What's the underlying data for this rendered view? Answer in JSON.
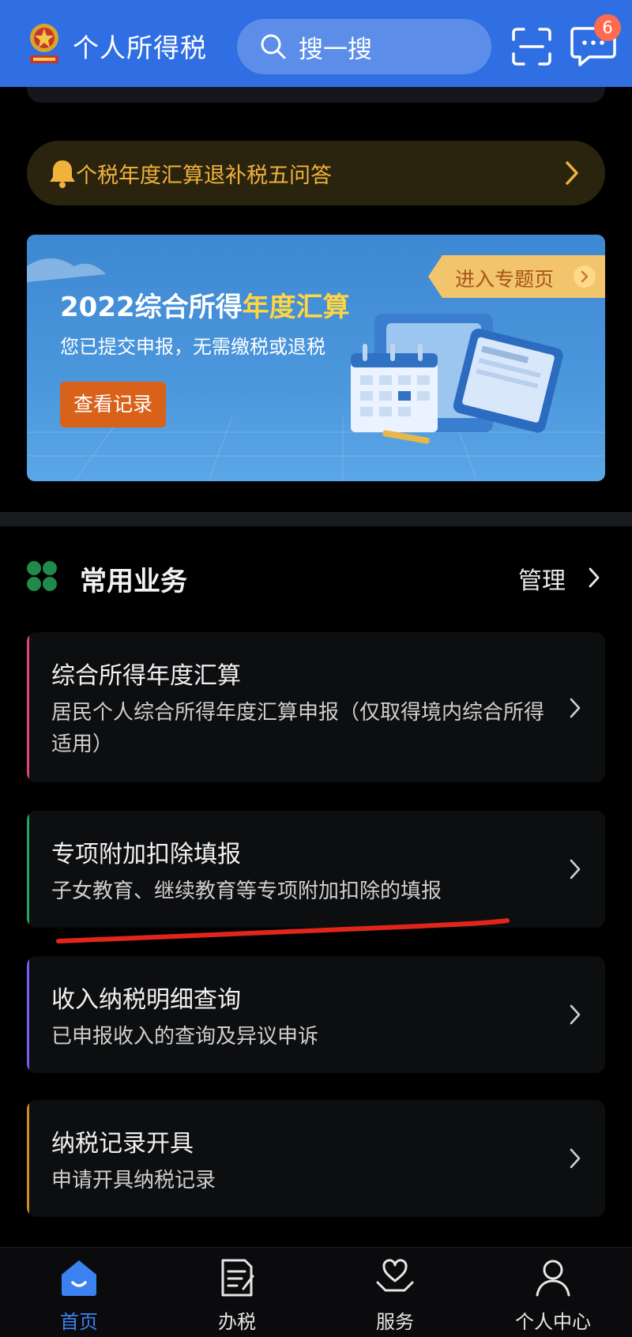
{
  "header": {
    "app_title": "个人所得税",
    "search_placeholder": "搜一搜",
    "message_badge": "6"
  },
  "notice": {
    "text": "个税年度汇算退补税五问答"
  },
  "banner": {
    "title_part1": "2022综合所得",
    "title_highlight": "年度汇算",
    "subtitle": "您已提交申报，无需缴税或退税",
    "record_button": "查看记录",
    "topic_button": "进入专题页"
  },
  "section": {
    "title": "常用业务",
    "manage_label": "管理"
  },
  "services": [
    {
      "title": "综合所得年度汇算",
      "desc": "居民个人综合所得年度汇算申报（仅取得境内综合所得适用）",
      "accent": "#e0447a"
    },
    {
      "title": "专项附加扣除填报",
      "desc": "子女教育、继续教育等专项附加扣除的填报",
      "accent": "#27a35a"
    },
    {
      "title": "收入纳税明细查询",
      "desc": "已申报收入的查询及异议申诉",
      "accent": "#7c5cf0"
    },
    {
      "title": "纳税记录开具",
      "desc": "申请开具纳税记录",
      "accent": "#d08a2a"
    }
  ],
  "bottom_nav": [
    {
      "label": "首页",
      "icon": "home-icon",
      "active": true
    },
    {
      "label": "办税",
      "icon": "tax-form-icon",
      "active": false
    },
    {
      "label": "服务",
      "icon": "heart-hand-icon",
      "active": false
    },
    {
      "label": "个人中心",
      "icon": "person-icon",
      "active": false
    }
  ],
  "colors": {
    "header_bg": "#2f6fe3",
    "notice_text": "#f0b23a",
    "banner_highlight": "#ffd640",
    "record_button_bg": "#d9621b",
    "nav_active": "#3b82f0",
    "annotation_line": "#e0261b"
  }
}
